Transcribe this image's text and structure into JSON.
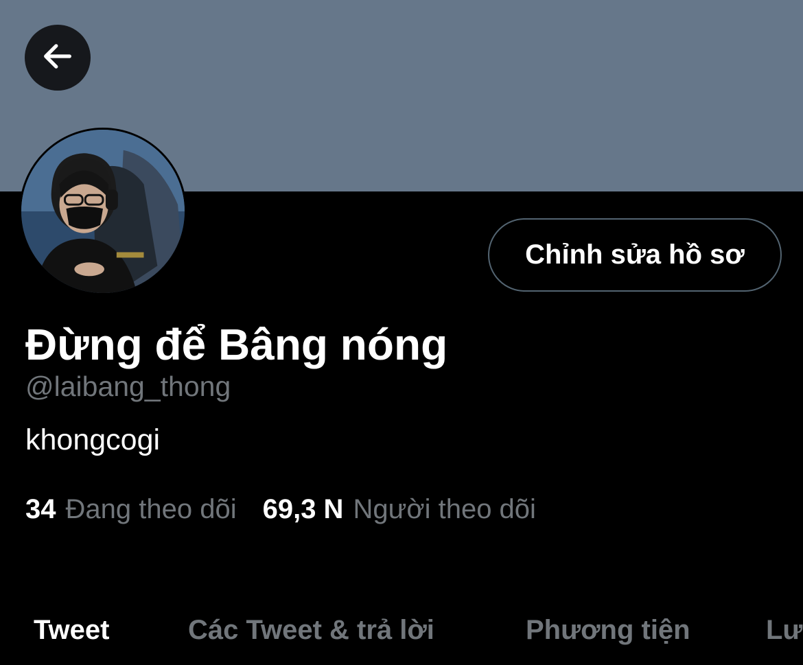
{
  "banner": {
    "color": "#66778a"
  },
  "header": {
    "back_icon": "arrow-left-icon"
  },
  "profile": {
    "edit_label": "Chỉnh sửa hồ sơ",
    "display_name": "Đừng để Bâng nóng",
    "handle": "@laibang_thong",
    "bio": "khongcogi"
  },
  "stats": {
    "following_count": "34",
    "following_label": "Đang theo dõi",
    "followers_count": "69,3 N",
    "followers_label": "Người theo dõi"
  },
  "tabs": [
    {
      "label": "Tweet",
      "active": true
    },
    {
      "label": "Các Tweet & trả lời",
      "active": false
    },
    {
      "label": "Phương tiện",
      "active": false
    },
    {
      "label": "Lượt thích",
      "active": false
    }
  ],
  "colors": {
    "background": "#000000",
    "text_primary": "#ffffff",
    "text_secondary": "#71767b",
    "button_border": "#536471"
  }
}
